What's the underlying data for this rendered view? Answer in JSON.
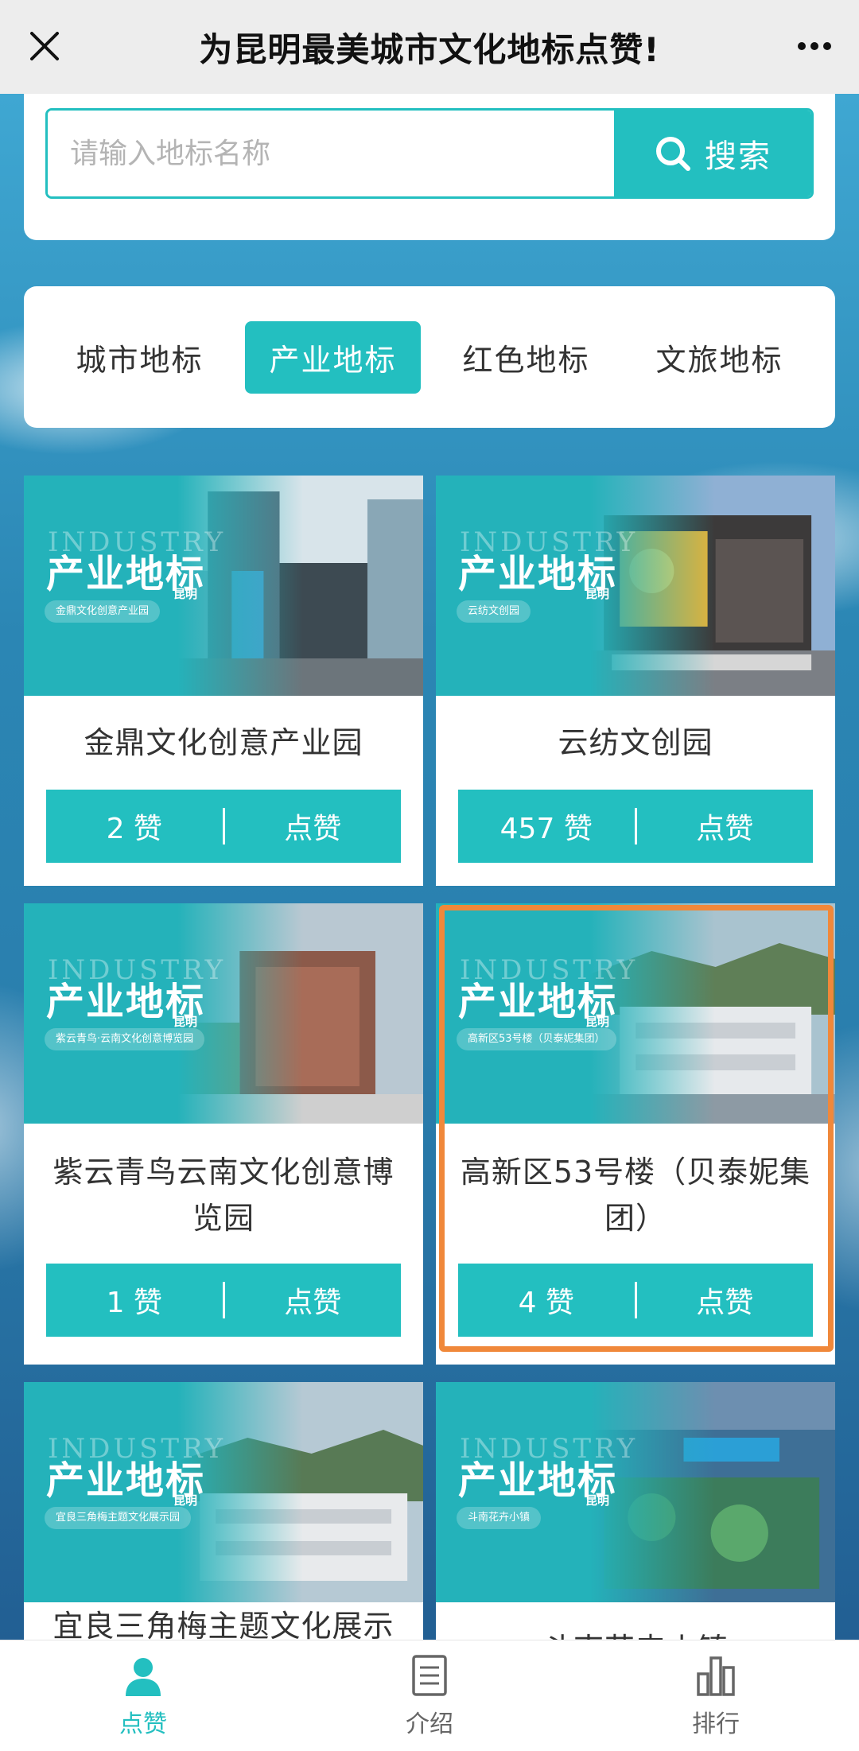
{
  "header": {
    "title": "为昆明最美城市文化地标点赞!",
    "close_icon": "close-icon",
    "more_icon": "more-dots-icon"
  },
  "search": {
    "placeholder": "请输入地标名称",
    "button_label": "搜索",
    "icon": "search-icon"
  },
  "tabs": [
    {
      "label": "城市地标",
      "active": false
    },
    {
      "label": "产业地标",
      "active": true
    },
    {
      "label": "红色地标",
      "active": false
    },
    {
      "label": "文旅地标",
      "active": false
    }
  ],
  "cards": [
    {
      "banner_en": "INDUSTRY",
      "banner_title": "产业地标",
      "banner_city": "昆明",
      "banner_sub": "金鼎文化创意产业园",
      "name": "金鼎文化创意产业园",
      "likes": "2 赞",
      "like_button": "点赞"
    },
    {
      "banner_en": "INDUSTRY",
      "banner_title": "产业地标",
      "banner_city": "昆明",
      "banner_sub": "云纺文创园",
      "name": "云纺文创园",
      "likes": "457 赞",
      "like_button": "点赞"
    },
    {
      "banner_en": "INDUSTRY",
      "banner_title": "产业地标",
      "banner_city": "昆明",
      "banner_sub": "紫云青鸟·云南文化创意博览园",
      "name": "紫云青鸟云南文化创意博览园",
      "likes": "1 赞",
      "like_button": "点赞"
    },
    {
      "banner_en": "INDUSTRY",
      "banner_title": "产业地标",
      "banner_city": "昆明",
      "banner_sub": "高新区53号楼（贝泰妮集团）",
      "name": "高新区53号楼（贝泰妮集团）",
      "likes": "4 赞",
      "like_button": "点赞"
    },
    {
      "banner_en": "INDUSTRY",
      "banner_title": "产业地标",
      "banner_city": "昆明",
      "banner_sub": "宜良三角梅主题文化展示园",
      "name": "宜良三角梅主题文化展示园",
      "likes": "",
      "like_button": ""
    },
    {
      "banner_en": "INDUSTRY",
      "banner_title": "产业地标",
      "banner_city": "昆明",
      "banner_sub": "斗南花卉小镇",
      "name": "斗南花卉小镇",
      "likes": "",
      "like_button": ""
    }
  ],
  "bottom_nav": [
    {
      "label": "点赞",
      "icon": "user-icon",
      "active": true
    },
    {
      "label": "介绍",
      "icon": "document-icon",
      "active": false
    },
    {
      "label": "排行",
      "icon": "bar-chart-icon",
      "active": false
    }
  ],
  "colors": {
    "accent": "#23bfc0",
    "highlight_border": "#f0883a",
    "header_bg": "#ededed"
  }
}
